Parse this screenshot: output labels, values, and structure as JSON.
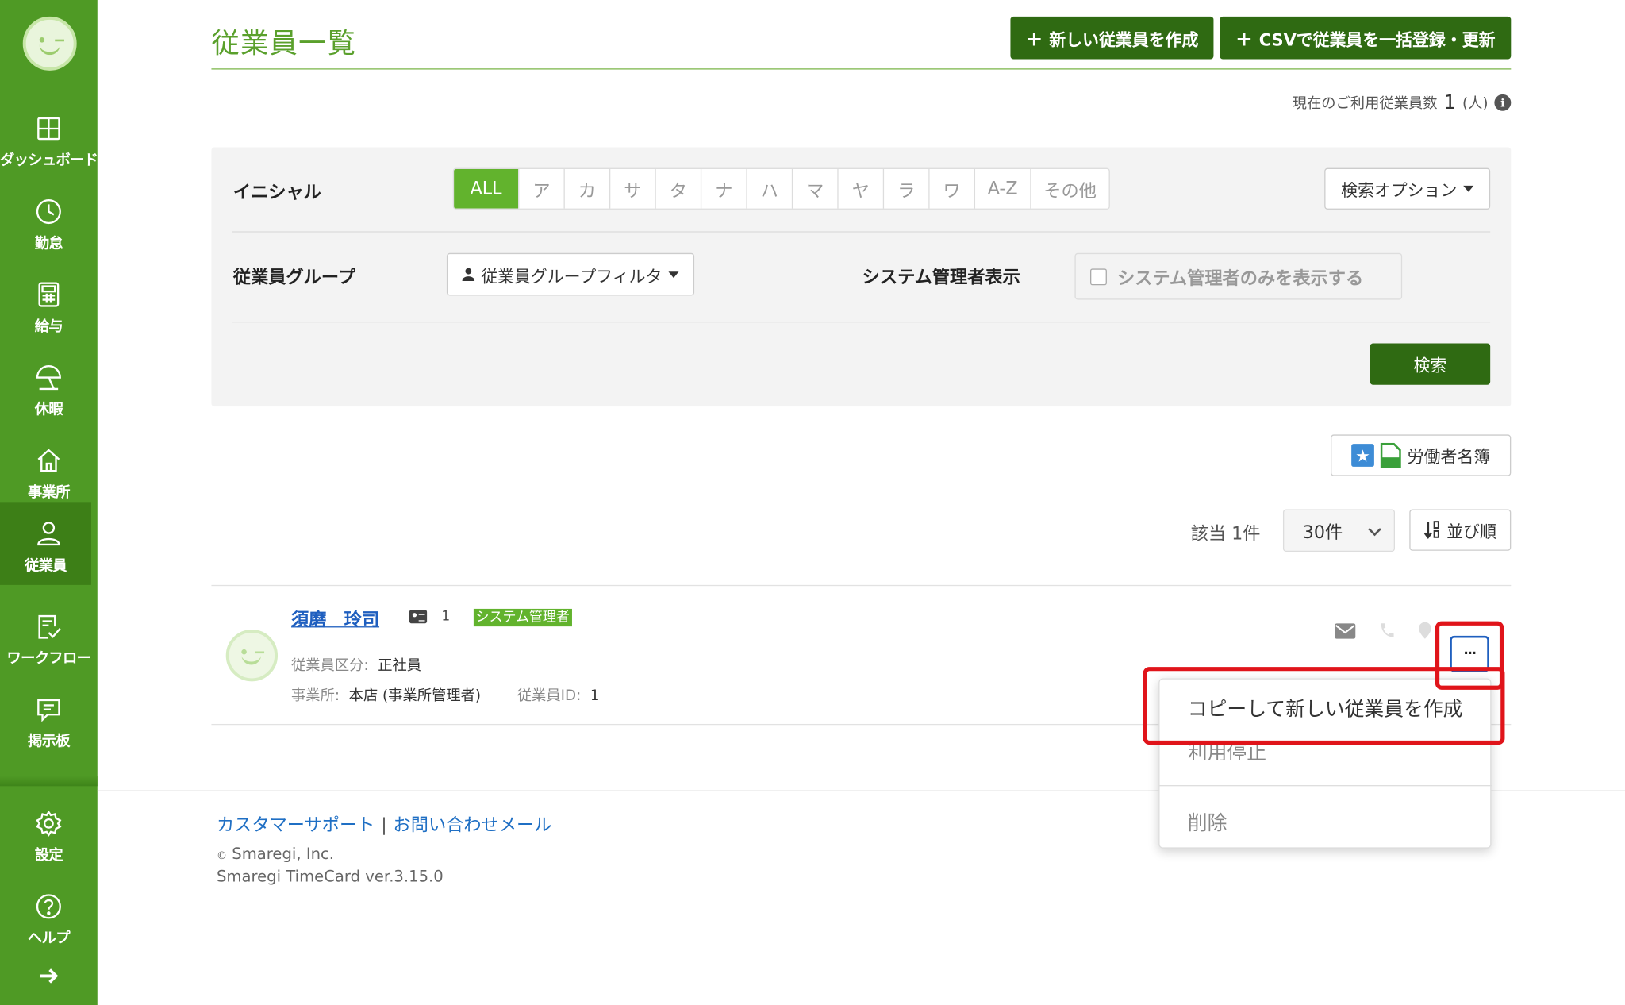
{
  "sidebar": {
    "items": [
      {
        "label": "ダッシュボード",
        "icon": "dashboard-icon"
      },
      {
        "label": "勤怠",
        "icon": "clock-icon"
      },
      {
        "label": "給与",
        "icon": "calculator-icon"
      },
      {
        "label": "休暇",
        "icon": "umbrella-icon"
      },
      {
        "label": "事業所",
        "icon": "home-icon"
      },
      {
        "label": "従業員",
        "icon": "user-icon"
      },
      {
        "label": "ワークフロー",
        "icon": "checklist-icon"
      },
      {
        "label": "掲示板",
        "icon": "message-icon"
      },
      {
        "label": "設定",
        "icon": "gear-icon"
      },
      {
        "label": "ヘルプ",
        "icon": "help-icon"
      }
    ],
    "active": "従業員"
  },
  "header": {
    "title": "従業員一覧",
    "new_employee_button": "新しい従業員を作成",
    "csv_button": "CSVで従業員を一括登録・更新",
    "usage_label": "現在のご利用従業員数",
    "usage_count": "1",
    "usage_unit": "(人)"
  },
  "filter": {
    "initial_label": "イニシャル",
    "initials": [
      "ALL",
      "ア",
      "カ",
      "サ",
      "タ",
      "ナ",
      "ハ",
      "マ",
      "ヤ",
      "ラ",
      "ワ",
      "A-Z",
      "その他"
    ],
    "selected_initial": "ALL",
    "search_options_button": "検索オプション",
    "group_label": "従業員グループ",
    "group_filter_button": "従業員グループフィルタ",
    "admin_display_label": "システム管理者表示",
    "admin_only_checkbox": "システム管理者のみを表示する",
    "search_button": "検索"
  },
  "results": {
    "roster_button": "労働者名簿",
    "count_text": "該当 1件",
    "per_page": "30件",
    "sort_button": "並び順"
  },
  "employee": {
    "name": "須磨　玲司",
    "number": "1",
    "badge": "システム管理者",
    "type_label": "従業員区分:",
    "type_value": "正社員",
    "office_label": "事業所:",
    "office_value": "本店 (事業所管理者)",
    "id_label": "従業員ID:",
    "id_value": "1",
    "more_button": "···"
  },
  "dropdown": {
    "items": [
      "コピーして新しい従業員を作成",
      "利用停止",
      "削除"
    ]
  },
  "footer": {
    "support_link": "カスタマーサポート",
    "separator": "|",
    "contact_link": "お問い合わせメール",
    "copyright_symbol": "©",
    "company": "Smaregi, Inc.",
    "version": "Smaregi TimeCard ver.3.15.0"
  },
  "colors": {
    "sidebar": "#4f9a25",
    "title": "#5aa02c",
    "dark_button": "#2f6a12",
    "highlight": "#e0141a",
    "link": "#1f6fc4"
  }
}
